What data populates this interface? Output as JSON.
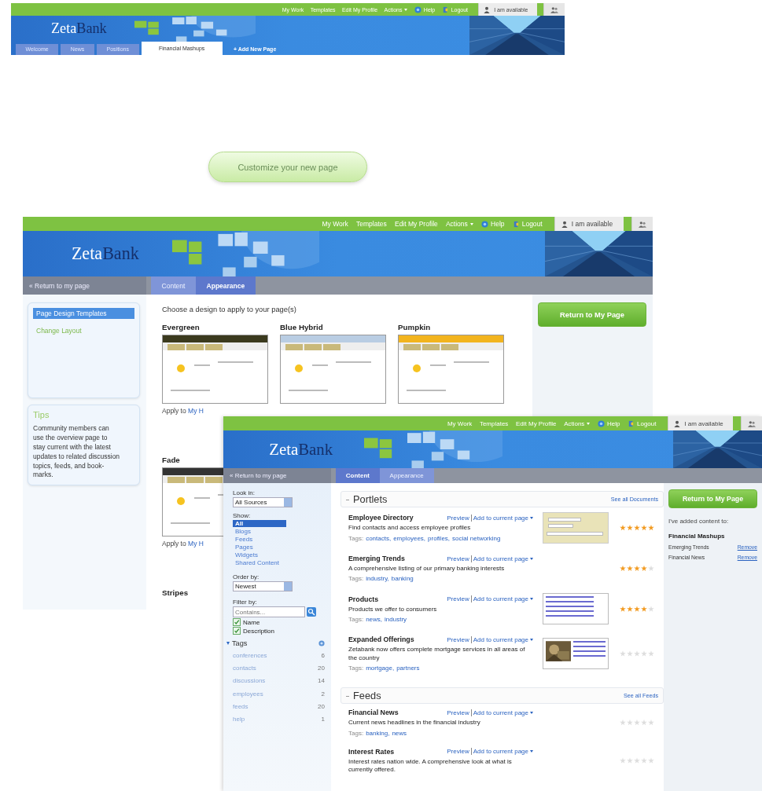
{
  "screens": [
    {
      "kind": "tabs_page",
      "header": {
        "logo": [
          "Zeta",
          "Bank"
        ],
        "links": [
          {
            "label": "My Work",
            "kind": "link"
          },
          {
            "label": "Templates",
            "kind": "link"
          },
          {
            "label": "Edit My Profile",
            "kind": "link"
          },
          {
            "label": "Actions",
            "kind": "menu"
          },
          {
            "label": "Help",
            "kind": "help"
          },
          {
            "label": "Logout",
            "kind": "logout"
          }
        ],
        "status": "I am available"
      },
      "tabs": [
        {
          "label": "Welcome",
          "selected": false
        },
        {
          "label": "News",
          "selected": false
        },
        {
          "label": "Positions",
          "selected": false
        },
        {
          "label": "Financial Mashups",
          "selected": true
        }
      ],
      "add_page": "+ Add New Page"
    },
    {
      "kind": "appearance",
      "header": {
        "logo": [
          "Zeta",
          "Bank"
        ],
        "links": [
          {
            "label": "My Work",
            "kind": "link"
          },
          {
            "label": "Templates",
            "kind": "link"
          },
          {
            "label": "Edit My Profile",
            "kind": "link"
          },
          {
            "label": "Actions",
            "kind": "menu"
          },
          {
            "label": "Help",
            "kind": "help"
          },
          {
            "label": "Logout",
            "kind": "logout"
          }
        ],
        "status": "I am available"
      },
      "back": "« Return to my page",
      "tabs": [
        {
          "label": "Content",
          "selected": false
        },
        {
          "label": "Appearance",
          "selected": true
        }
      ],
      "menu": [
        {
          "label": "Page Design Templates",
          "selected": true
        },
        {
          "label": "Change Layout",
          "selected": false
        }
      ],
      "tips": {
        "title": "Tips",
        "text": "Community members can use the overview page to stay current with the latest updates to related discussion topics, feeds, and book-marks."
      },
      "heading": "Choose a design to apply to your page(s)",
      "templates": [
        {
          "name": "Evergreen",
          "color": "#3b3a1e",
          "apply": "Apply to",
          "link": "My H"
        },
        {
          "name": "Blue Hybrid",
          "color": "#b9cde3"
        },
        {
          "name": "Pumpkin",
          "color": "#f2b41e"
        },
        {
          "name": "Fade",
          "color": "#333333",
          "apply": "Apply to",
          "link": "My H"
        },
        {
          "name": "Stripes"
        }
      ],
      "return_button": "Return to My Page"
    },
    {
      "kind": "content",
      "header": {
        "logo": [
          "Zeta",
          "Bank"
        ],
        "links": [
          {
            "label": "My Work",
            "kind": "link"
          },
          {
            "label": "Templates",
            "kind": "link"
          },
          {
            "label": "Edit My Profile",
            "kind": "link"
          },
          {
            "label": "Actions",
            "kind": "menu"
          },
          {
            "label": "Help",
            "kind": "help"
          },
          {
            "label": "Logout",
            "kind": "logout"
          }
        ],
        "status": "I am available"
      },
      "back": "« Return to my page",
      "tabs": [
        {
          "label": "Content",
          "selected": true
        },
        {
          "label": "Appearance",
          "selected": false
        }
      ],
      "filters": {
        "look_in_label": "Look in:",
        "look_in": "All Sources",
        "show_label": "Show:",
        "show": [
          {
            "label": "All",
            "selected": true
          },
          {
            "label": "Blogs",
            "selected": false
          },
          {
            "label": "Feeds",
            "selected": false
          },
          {
            "label": "Pages",
            "selected": false
          },
          {
            "label": "Widgets",
            "selected": false
          },
          {
            "label": "Shared Content",
            "selected": false
          }
        ],
        "order_label": "Order by:",
        "order": "Newest",
        "filter_label": "Filter by:",
        "filter_placeholder": "Contains...",
        "checks": [
          {
            "label": "Name",
            "checked": true
          },
          {
            "label": "Description",
            "checked": true
          }
        ],
        "tags_label": "Tags",
        "tags": [
          {
            "name": "conferences",
            "count": "6"
          },
          {
            "name": "contacts",
            "count": "20"
          },
          {
            "name": "discussions",
            "count": "14"
          },
          {
            "name": "employees",
            "count": "2"
          },
          {
            "name": "feeds",
            "count": "20"
          },
          {
            "name": "help",
            "count": "1"
          }
        ]
      },
      "sections": [
        {
          "title": "Portlets",
          "see_all": "See all Documents",
          "items": [
            {
              "title": "Employee Directory",
              "preview": "Preview",
              "add": "Add to current page",
              "description": "Find contacts and access employee profiles",
              "tags_label": "Tags:",
              "tags": [
                "contacts,",
                "employees,",
                "profiles,",
                "social networking"
              ],
              "stars": 5,
              "thumb": {
                "kind": "form"
              }
            },
            {
              "title": "Emerging Trends",
              "preview": "Preview",
              "add": "Add to current page",
              "description": "A comprehensive listing of our primary banking interests",
              "tags_label": "Tags:",
              "tags": [
                "industry,",
                "banking"
              ],
              "stars": 4
            },
            {
              "title": "Products",
              "preview": "Preview",
              "add": "Add to current page",
              "description": "Products we offer to consumers",
              "tags_label": "Tags:",
              "tags": [
                "news,",
                "industry"
              ],
              "stars": 4,
              "thumb": {
                "kind": "list"
              }
            },
            {
              "title": "Expanded Offerings",
              "preview": "Preview",
              "add": "Add to current page",
              "description": "Zetabank now offers complete mortgage services in all areas of the country",
              "tags_label": "Tags:",
              "tags": [
                "mortgage,",
                "partners"
              ],
              "stars": 0,
              "thumb": {
                "kind": "article"
              }
            }
          ]
        },
        {
          "title": "Feeds",
          "see_all": "See all Feeds",
          "items": [
            {
              "title": "Financial News",
              "preview": "Preview",
              "add": "Add to current page",
              "description": "Current news headlines in the financial industry",
              "tags_label": "Tags:",
              "tags": [
                "banking,",
                "news"
              ],
              "stars": 0
            },
            {
              "title": "Interest Rates",
              "preview": "Preview",
              "add": "Add to current page",
              "description": "Interest rates nation wide. A comprehensive look at what is currently offered.",
              "stars": 0
            }
          ]
        }
      ],
      "panel": {
        "button": "Return to My Page",
        "note": "I've added content to:",
        "page": "Financial Mashups",
        "added": [
          {
            "name": "Emerging Trends",
            "action": "Remove"
          },
          {
            "name": "Financial News",
            "action": "Remove"
          }
        ]
      }
    }
  ],
  "customize_button": "Customize your new page"
}
